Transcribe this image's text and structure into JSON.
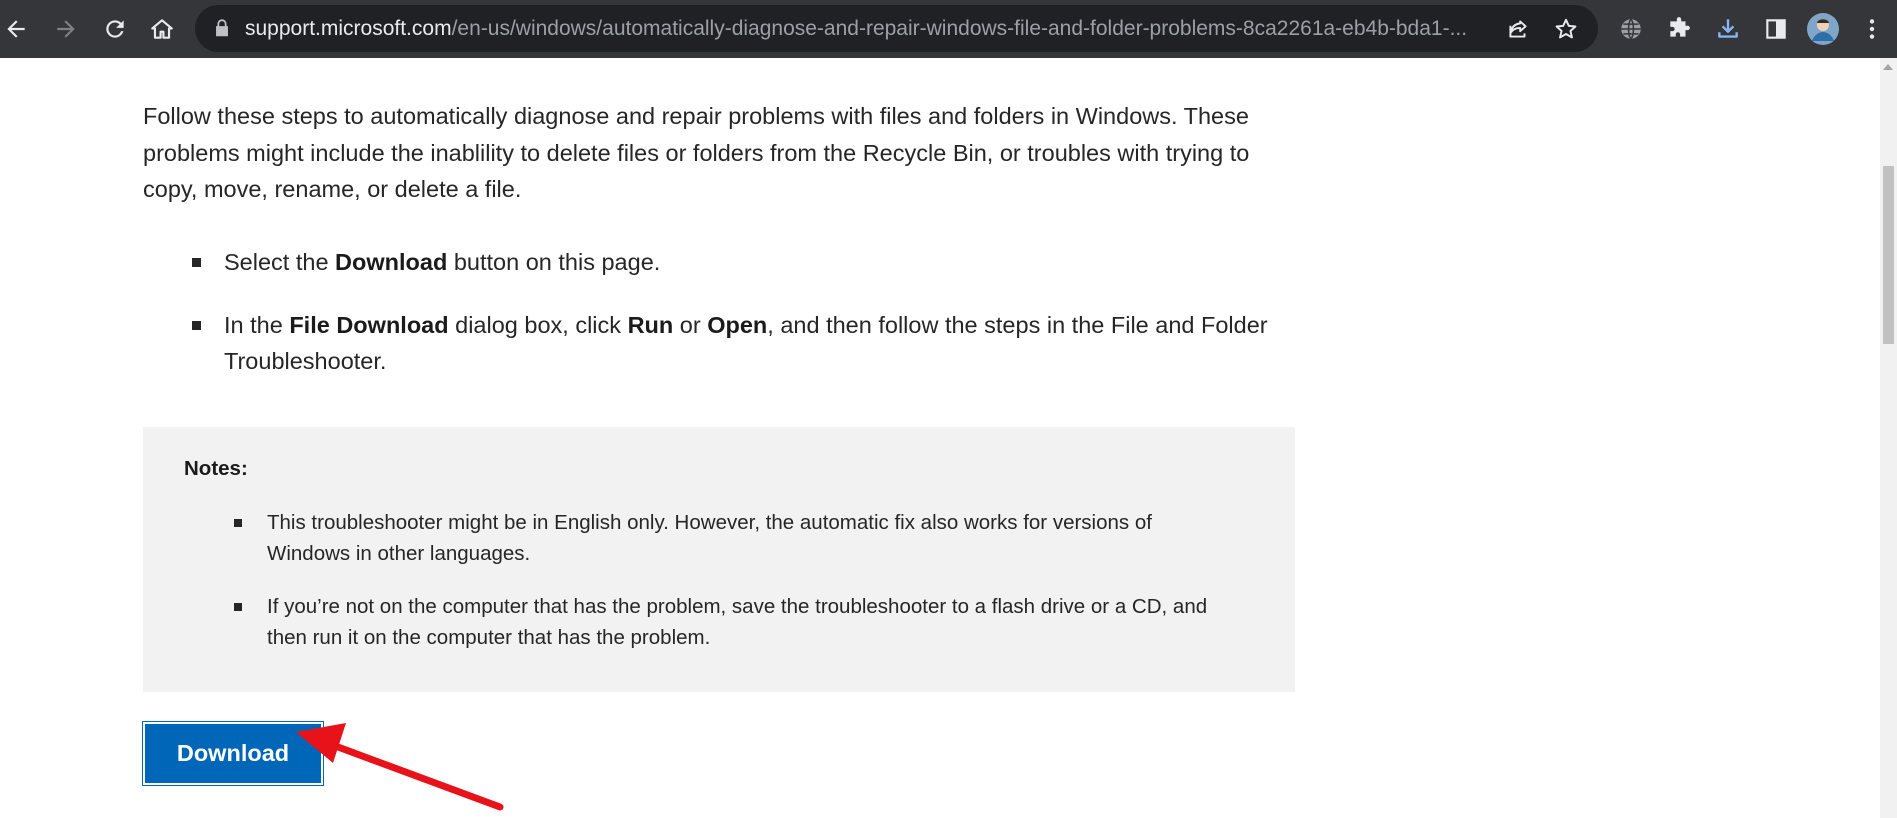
{
  "browser": {
    "url_host": "support.microsoft.com",
    "url_path": "/en-us/windows/automatically-diagnose-and-repair-windows-file-and-folder-problems-8ca2261a-eb4b-bda1-...",
    "icons": [
      "back-icon",
      "forward-icon",
      "reload-icon",
      "home-icon",
      "lock-icon",
      "share-icon",
      "star-icon",
      "globe-icon",
      "extensions-icon",
      "download-icon",
      "side-panel-icon",
      "avatar",
      "menu-icon"
    ]
  },
  "article": {
    "intro": "Follow these steps to automatically diagnose and repair problems with files and folders in Windows. These problems might include the inablility to delete files or folders from the Recycle Bin, or troubles with trying to copy, move, rename, or delete a file.",
    "step1": {
      "pre": "Select the ",
      "bold": "Download",
      "post": " button on this page."
    },
    "step2": {
      "pre": "In the ",
      "bold1": "File Download",
      "mid1": " dialog box, click ",
      "bold2": "Run",
      "mid2": " or ",
      "bold3": "Open",
      "post": ", and then follow the steps in the File and Folder Troubleshooter."
    },
    "notes": {
      "title": "Notes:",
      "items": [
        "This troubleshooter might be in English only. However, the automatic fix also works for versions of Windows in other languages.",
        "If you’re not on the computer that has the problem, save the troubleshooter to a flash drive or a CD, and then run it on the computer that has the problem."
      ]
    },
    "download_button": "Download"
  },
  "colors": {
    "toolbar": "#35363a",
    "omnibox": "#202124",
    "button_blue": "#0067b8",
    "notes_bg": "#f2f2f2",
    "annotation_arrow": "#e8121b",
    "download_icon": "#8ab4f8"
  }
}
